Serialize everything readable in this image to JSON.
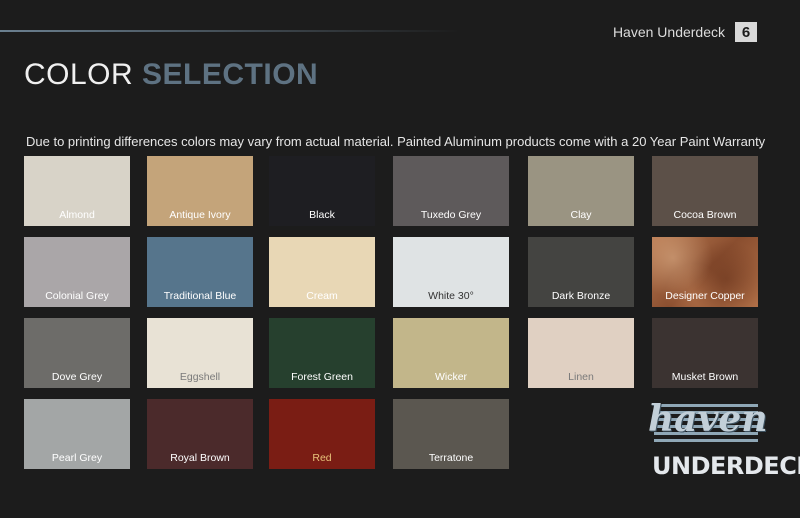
{
  "header": {
    "brand": "Haven Underdeck",
    "page_number": "6"
  },
  "title": {
    "light": "COLOR ",
    "bold": "SELECTION"
  },
  "disclaimer": "Due to printing differences colors may vary from actual material. Painted Aluminum products come with a 20 Year Paint Warranty",
  "swatches": [
    {
      "name": "Almond",
      "color": "#d8d3c8",
      "label_color": "#ffffff"
    },
    {
      "name": "Antique Ivory",
      "color": "#c4a47a",
      "label_color": "#ffffff"
    },
    {
      "name": "Black",
      "color": "#1e1e22",
      "label_color": "#ffffff"
    },
    {
      "name": "Tuxedo Grey",
      "color": "#5e5a5b",
      "label_color": "#ffffff"
    },
    {
      "name": "Clay",
      "color": "#9a9482",
      "label_color": "#ffffff"
    },
    {
      "name": "Cocoa Brown",
      "color": "#5c5048",
      "label_color": "#ffffff"
    },
    {
      "name": "Colonial Grey",
      "color": "#aaa6a8",
      "label_color": "#ffffff"
    },
    {
      "name": "Traditional Blue",
      "color": "#56758c",
      "label_color": "#ffffff"
    },
    {
      "name": "Cream",
      "color": "#e8d7b5",
      "label_color": "#ffffff"
    },
    {
      "name": "White 30°",
      "color": "#dfe3e4",
      "label_color": "#333333"
    },
    {
      "name": "Dark Bronze",
      "color": "#444441",
      "label_color": "#ffffff"
    },
    {
      "name": "Designer Copper",
      "color": "#a86a45",
      "label_color": "#ffffff"
    },
    {
      "name": "Dove Grey",
      "color": "#6d6c69",
      "label_color": "#ffffff"
    },
    {
      "name": "Eggshell",
      "color": "#e8e2d5",
      "label_color": "#7a7a7a"
    },
    {
      "name": "Forest Green",
      "color": "#26402e",
      "label_color": "#ffffff"
    },
    {
      "name": "Wicker",
      "color": "#c2b68a",
      "label_color": "#ffffff"
    },
    {
      "name": "Linen",
      "color": "#e0d0c2",
      "label_color": "#7a7a7a"
    },
    {
      "name": "Musket Brown",
      "color": "#3b3331",
      "label_color": "#ffffff"
    },
    {
      "name": "Pearl Grey",
      "color": "#a3a6a6",
      "label_color": "#ffffff"
    },
    {
      "name": "Royal Brown",
      "color": "#4b2a2b",
      "label_color": "#ffffff"
    },
    {
      "name": "Red",
      "color": "#7a1d14",
      "label_color": "#e8c27a"
    },
    {
      "name": "Terratone",
      "color": "#5b5750",
      "label_color": "#ffffff"
    }
  ],
  "logo": {
    "script": "haven",
    "sub": "UNDERDECK"
  }
}
